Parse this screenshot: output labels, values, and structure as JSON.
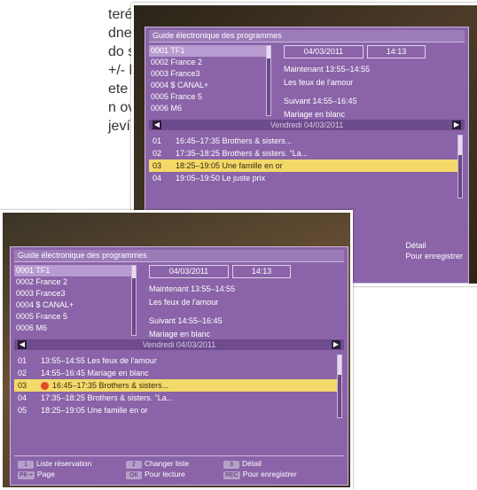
{
  "manual_text": [
    "terém si",
    "dne.",
    "do spodní",
    "+/- k",
    "ete nahrávat.",
    "n ovladači.",
    "jeví červený"
  ],
  "epg": {
    "title": "Guide électronique des programmes",
    "channels": [
      "0001 TF1",
      "0002 France 2",
      "0003 France3",
      "0004 $ CANAL+",
      "0005 France 5",
      "0006 M6"
    ],
    "date": "04/03/2011",
    "time": "14:13",
    "now_label": "Maintenant 13:55–14:55",
    "now_title": "Les feux de l'amour",
    "next_label": "Suivant 14:55–16:45",
    "next_title": "Mariage en blanc",
    "day_label": "Vendredi 04/03/2011"
  },
  "back_events": [
    {
      "num": "01",
      "text": "16:45–17:35 Brothers & sisters..."
    },
    {
      "num": "02",
      "text": "17:35–18:25 Brothers & sisters. \"La..."
    },
    {
      "num": "03",
      "text": "18:25–19:05 Une famille en or"
    },
    {
      "num": "04",
      "text": "19:05–19:50 Le juste prix"
    }
  ],
  "front_events": [
    {
      "num": "01",
      "text": "13:55–14:55 Les feux de l'amour"
    },
    {
      "num": "02",
      "text": "14:55–16:45 Mariage en blanc"
    },
    {
      "num": "03",
      "text": "16:45–17:35 Brothers & sisters..."
    },
    {
      "num": "04",
      "text": "17:35–18:25 Brothers & sisters. \"La..."
    },
    {
      "num": "05",
      "text": "18:25–19:05 Une famille en or"
    }
  ],
  "footer": {
    "key1": "1",
    "label1": "Liste réservation",
    "key2": "2",
    "label2": "Changer liste",
    "key3": "3",
    "label3": "Détail",
    "key4": "P6-+",
    "label4": "Page",
    "key5": "OK",
    "label5": "Pour lecture",
    "key6": "REC",
    "label6": "Pour enregistrer"
  },
  "back_footer": {
    "detail": "Détail",
    "record": "Pour enregistrer"
  }
}
